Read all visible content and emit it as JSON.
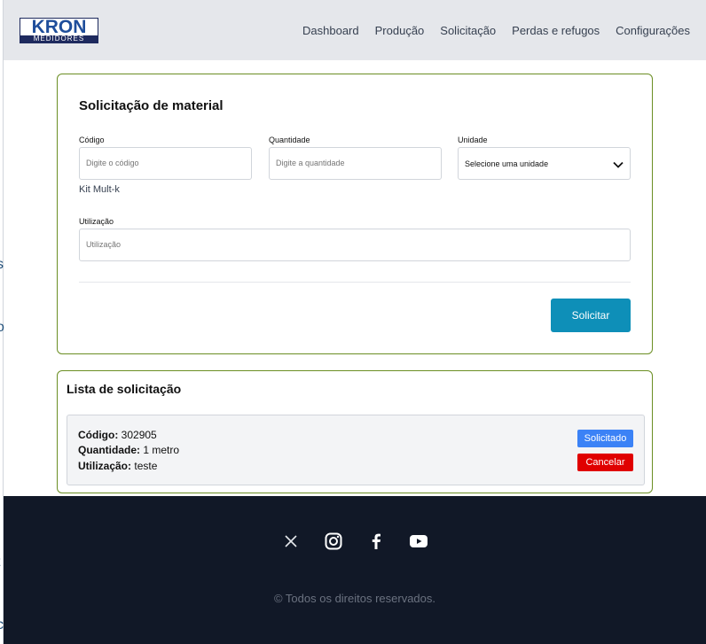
{
  "brand": {
    "logo_main": "KRON",
    "logo_sub": "MEDIDORES"
  },
  "nav": {
    "items": [
      "Dashboard",
      "Produção",
      "Solicitação",
      "Perdas e refugos",
      "Configurações"
    ]
  },
  "form": {
    "title": "Solicitação de material",
    "codigo_label": "Código",
    "codigo_placeholder": "Digite o código",
    "codigo_hint": "Kit Mult-k",
    "quantidade_label": "Quantidade",
    "quantidade_placeholder": "Digite a quantidade",
    "unidade_label": "Unidade",
    "unidade_value": "Selecione uma unidade",
    "utilizacao_label": "Utilização",
    "utilizacao_placeholder": "Utilização",
    "submit_label": "Solicitar"
  },
  "list": {
    "title": "Lista de solicitação",
    "items": [
      {
        "codigo_label": "Código:",
        "codigo": "302905",
        "quantidade_label": "Quantidade:",
        "quantidade": "1 metro",
        "utilizacao_label": "Utilização:",
        "utilizacao": "teste",
        "status_label": "Solicitado",
        "cancel_label": "Cancelar"
      }
    ]
  },
  "footer": {
    "icons": [
      "x-icon",
      "instagram-icon",
      "facebook-icon",
      "youtube-icon"
    ],
    "copyright": "© Todos os direitos reservados."
  },
  "colors": {
    "accent": "#0e8fb8",
    "card_border": "#6b8e23",
    "status_blue": "#3b82f6",
    "cancel_red": "#e00000",
    "footer_bg": "#111827"
  }
}
